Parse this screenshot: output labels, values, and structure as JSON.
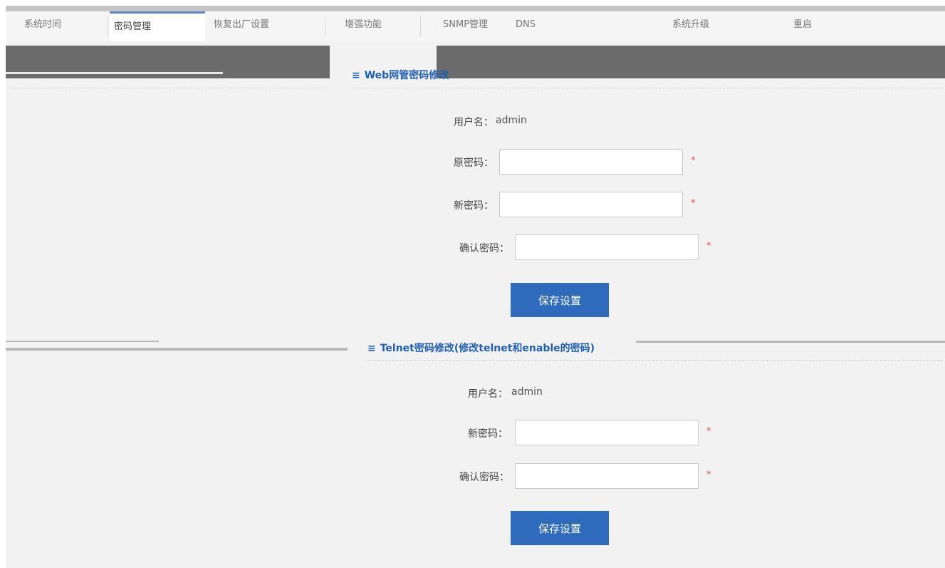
{
  "tabs": [
    {
      "label": "系统时间"
    },
    {
      "label": "密码管理"
    },
    {
      "label": "恢复出厂设置"
    },
    {
      "label": "增强功能"
    },
    {
      "label": "SNMP管理"
    },
    {
      "label": "DNS"
    },
    {
      "label": "系统升级"
    },
    {
      "label": "重启"
    }
  ],
  "web_section": {
    "title": "Web网管密码修改",
    "username_label": "用户名：",
    "username_value": "admin",
    "old_password_label": "原密码：",
    "new_password_label": "新密码：",
    "confirm_label": "确认密码：",
    "required_mark": "*",
    "save_label": "保存设置"
  },
  "telnet_section": {
    "title": "Telnet密码修改(修改telnet和enable的密码)",
    "username_label": "用户名：",
    "username_value": "admin",
    "new_password_label": "新密码：",
    "confirm_label": "确认密码：",
    "required_mark": "*",
    "save_label": "保存设置"
  },
  "icons": {
    "section": "menu-lines-icon"
  },
  "colors": {
    "accent": "#2f6bbd",
    "title": "#1e5fb4",
    "required": "#d9534f"
  }
}
